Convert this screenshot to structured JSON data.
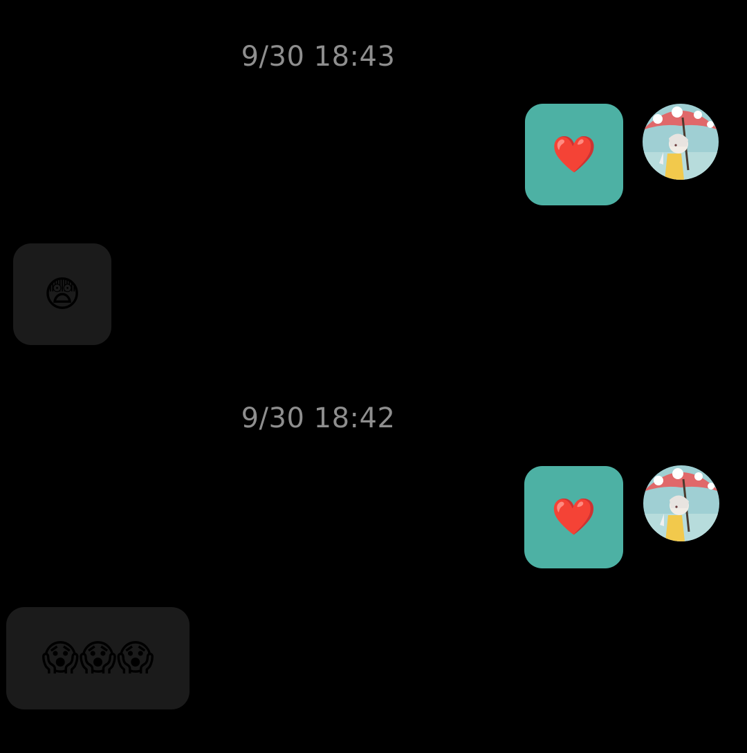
{
  "messages": [
    {
      "id": "m1",
      "kind": "timestamp",
      "text": "9/30  18:43"
    },
    {
      "id": "m2",
      "kind": "sent",
      "content": "❤️",
      "avatar_icon": "avatar-girl-umbrella"
    },
    {
      "id": "m3",
      "kind": "received",
      "content": "😨"
    },
    {
      "id": "m4",
      "kind": "timestamp",
      "text": "9/30  18:42"
    },
    {
      "id": "m5",
      "kind": "sent",
      "content": "❤️",
      "avatar_icon": "avatar-girl-umbrella"
    },
    {
      "id": "m6",
      "kind": "received",
      "content": "😱😱😱"
    }
  ],
  "colors": {
    "background": "#000000",
    "sent_bubble": "#4db1a4",
    "received_bubble": "#1b1b1b",
    "timestamp_text": "#8e8e8e"
  }
}
